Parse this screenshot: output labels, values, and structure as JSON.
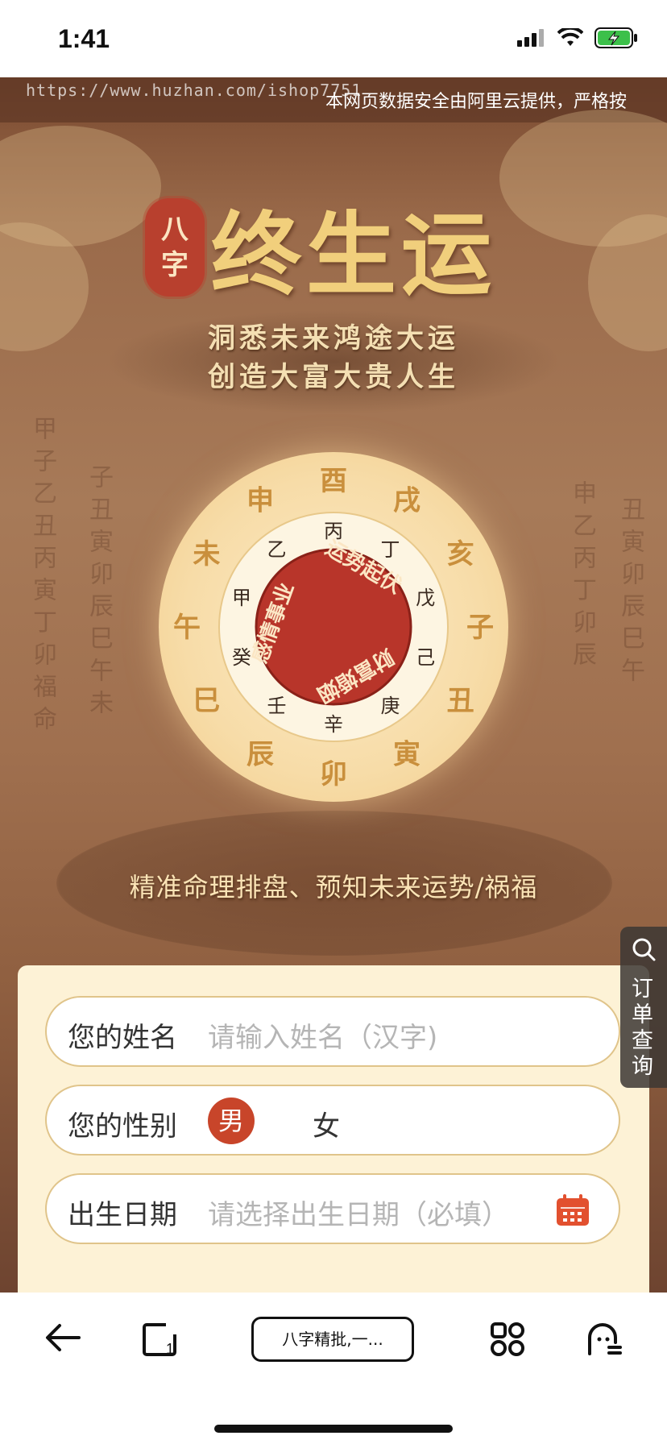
{
  "status_bar": {
    "time": "1:41"
  },
  "banner": {
    "url_watermark": "https://www.huzhan.com/ishop7751",
    "notice": "本网页数据安全由阿里云提供，严格按"
  },
  "hero": {
    "seal_chars": [
      "八",
      "字"
    ],
    "title": "终生运",
    "subtitle_lines": [
      "洞悉未来鸿途大运",
      "创造大富大贵人生"
    ],
    "wheel": {
      "outer_ring": [
        "申",
        "酉",
        "戌",
        "亥",
        "子",
        "丑",
        "寅",
        "卯",
        "辰",
        "巳",
        "午",
        "未"
      ],
      "middle_ring": [
        "丙",
        "丁",
        "戊",
        "己",
        "庚",
        "辛",
        "壬",
        "癸",
        "甲",
        "乙"
      ],
      "center_words": [
        "运势起伏",
        "财富婚姻",
        "感情事业"
      ]
    },
    "tagline": "精准命理排盘、预知未来运势/祸福"
  },
  "form": {
    "name": {
      "label": "您的姓名",
      "placeholder": "请输入姓名（汉字)"
    },
    "gender": {
      "label": "您的性别",
      "options": [
        "男",
        "女"
      ],
      "selected": "男"
    },
    "birth": {
      "label": "出生日期",
      "placeholder": "请选择出生日期（必填）"
    }
  },
  "side_button": {
    "label": "订单查询",
    "icon": "search-icon"
  },
  "browser_bar": {
    "tab_title": "八字精批,一..."
  },
  "colors": {
    "accent": "#c8452a",
    "gold": "#f1cf7c",
    "form_bg": "#fdf2d6"
  }
}
